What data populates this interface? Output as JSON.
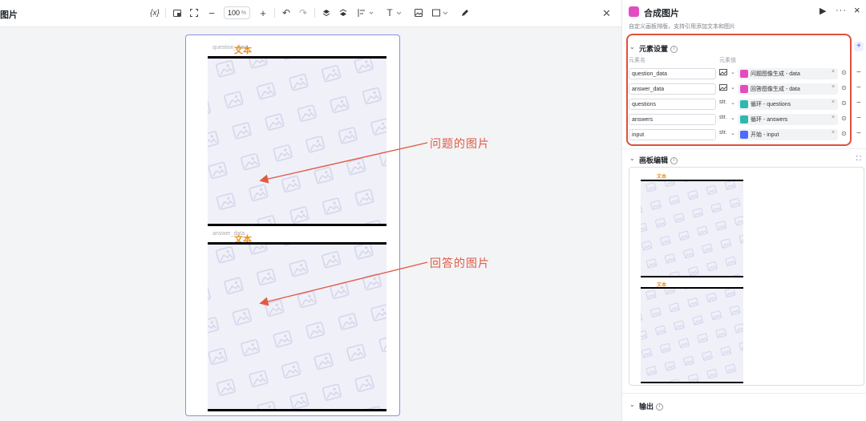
{
  "page": {
    "title": "图片",
    "close_icon": "close-icon"
  },
  "toolbar": {
    "variable_label": "{x}",
    "zoom_value": "100",
    "zoom_unit": "%",
    "minus": "−",
    "plus": "+",
    "text_tool": "T",
    "undo": "↶",
    "redo": "↷"
  },
  "canvas": {
    "block1": {
      "label": "question_data",
      "watermark": "文本"
    },
    "block2": {
      "label": "answer_data",
      "watermark": "文本"
    },
    "annotation1": "问题的图片",
    "annotation2": "回答的图片"
  },
  "node": {
    "title": "合成图片",
    "description": "自定义画板排版，支持引用添加文本和图片",
    "run_icon": "play-icon",
    "more": "···",
    "close": "×"
  },
  "elements": {
    "heading": "元素设置",
    "col_name": "元素名",
    "col_value": "元素值",
    "rows": [
      {
        "name": "question_data",
        "type": "image",
        "value": "问题图像生成 - data",
        "color": "#e34cc0"
      },
      {
        "name": "answer_data",
        "type": "image",
        "value": "回答图像生成 - data",
        "color": "#e34cc0"
      },
      {
        "name": "questions",
        "type": "str.",
        "value": "循环 - questions",
        "color": "#2fb7b0"
      },
      {
        "name": "answers",
        "type": "str.",
        "value": "循环 - answers",
        "color": "#2fb7b0"
      },
      {
        "name": "input",
        "type": "str.",
        "value": "开始 - input",
        "color": "#4d6bfe"
      }
    ]
  },
  "canvas_edit": {
    "heading": "画板编辑",
    "watermark1": "文本",
    "watermark2": "文本"
  },
  "output": {
    "heading": "输出"
  },
  "colors": {
    "accent": "#4d53e8",
    "highlight": "#e0503b",
    "watermark": "#f08c1a"
  }
}
